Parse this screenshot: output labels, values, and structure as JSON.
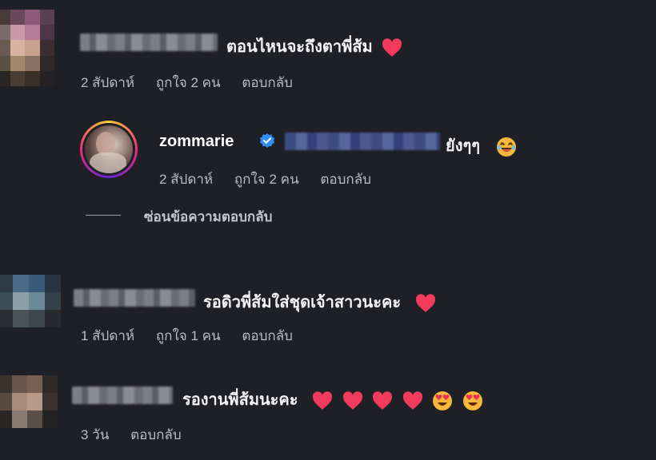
{
  "comments": [
    {
      "text": "ตอนไหนจะถึงตาพี่ส้ม",
      "emojis": [
        "heart"
      ],
      "meta": {
        "time": "2 สัปดาห์",
        "likes": "ถูกใจ 2 คน",
        "reply": "ตอบกลับ"
      }
    },
    {
      "username": "zommarie",
      "text": "ยังๆๆ",
      "emojis": [
        "laughing-face"
      ],
      "meta": {
        "time": "2 สัปดาห์",
        "likes": "ถูกใจ 2 คน",
        "reply": "ตอบกลับ"
      },
      "hide_replies": "ซ่อนข้อความตอบกลับ"
    },
    {
      "text": "รอดิวพี่ส้มใส่ชุดเจ้าสาวนะคะ",
      "emojis": [
        "heart"
      ],
      "meta": {
        "time": "1 สัปดาห์",
        "likes": "ถูกใจ 1 คน",
        "reply": "ตอบกลับ"
      }
    },
    {
      "text": "รองานพี่ส้มนะคะ",
      "emojis": [
        "heart",
        "heart",
        "heart",
        "heart",
        "heart-eyes-face",
        "heart-eyes-face"
      ],
      "meta": {
        "time": "3 วัน",
        "reply": "ตอบกลับ"
      }
    }
  ],
  "colors": {
    "background": "#1f2025",
    "heart": "#f23a5c",
    "verified": "#2f8ef5",
    "emoji_face": "#f6b73c"
  }
}
